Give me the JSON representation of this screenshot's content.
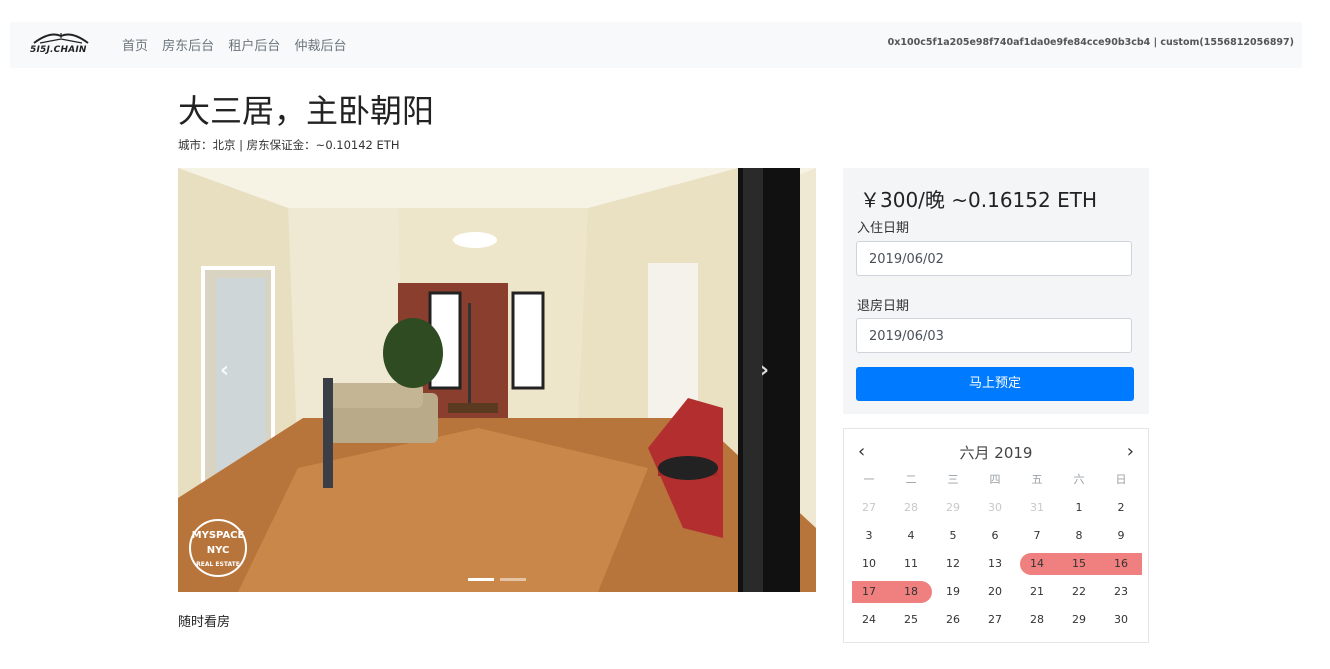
{
  "nav": {
    "logo_text": "5I5J.CHAIN",
    "links": [
      "首页",
      "房东后台",
      "租户后台",
      "仲裁后台"
    ],
    "account": "0x100c5f1a205e98f740af1da0e9fe84cce90b3cb4 | custom(1556812056897)"
  },
  "listing": {
    "title": "大三居，主卧朝阳",
    "subtitle": "城市：北京 | 房东保证金：~0.10142 ETH",
    "caption": "随时看房",
    "photo_badge": [
      "MYSPACE",
      "NYC",
      "REAL ESTATE"
    ]
  },
  "carousel": {
    "prev_icon": "chevron-left-icon",
    "next_icon": "chevron-right-icon",
    "prev_glyph": "‹",
    "next_glyph": "›",
    "slides": 2,
    "active_slide": 1
  },
  "booking": {
    "price": "￥300/晚 ~0.16152 ETH",
    "checkin_label": "入住日期",
    "checkin_value": "2019/06/02",
    "checkout_label": "退房日期",
    "checkout_value": "2019/06/03",
    "book_button": "马上预定"
  },
  "calendar": {
    "title": "六月 2019",
    "prev": "‹",
    "next": "›",
    "weekdays": [
      "一",
      "二",
      "三",
      "四",
      "五",
      "六",
      "日"
    ],
    "weeks": [
      [
        "27",
        "28",
        "29",
        "30",
        "31",
        "1",
        "2"
      ],
      [
        "3",
        "4",
        "5",
        "6",
        "7",
        "8",
        "9"
      ],
      [
        "10",
        "11",
        "12",
        "13",
        "14",
        "15",
        "16"
      ],
      [
        "17",
        "18",
        "19",
        "20",
        "21",
        "22",
        "23"
      ],
      [
        "24",
        "25",
        "26",
        "27",
        "28",
        "29",
        "30"
      ]
    ],
    "muted_days": [
      "27",
      "28",
      "29",
      "30",
      "31"
    ],
    "booked_ranges": [
      [
        "14",
        "16"
      ],
      [
        "17",
        "18"
      ]
    ],
    "booked_color": "#f08080"
  },
  "colors": {
    "primary": "#007bff",
    "navbar_bg": "#f8f9fa",
    "booked": "#f08080"
  }
}
